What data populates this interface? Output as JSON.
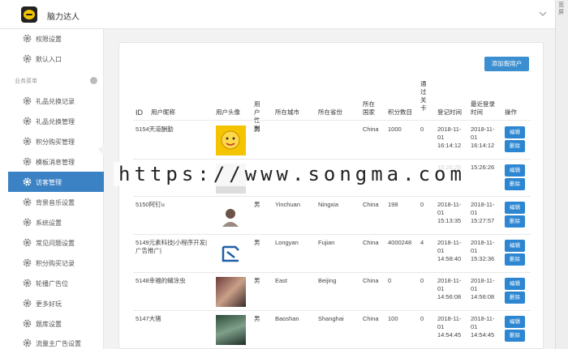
{
  "app": {
    "title": "脑力达人"
  },
  "rightstrip": {
    "text": "宽屏"
  },
  "sidebar": {
    "section_label": "业务菜单",
    "items": [
      {
        "label": "权限设置"
      },
      {
        "label": "默认入口"
      },
      {
        "label": "礼品兑换记录"
      },
      {
        "label": "礼品兑换管理"
      },
      {
        "label": "积分购买管理"
      },
      {
        "label": "模板消息管理"
      },
      {
        "label": "访客管理",
        "active": true
      },
      {
        "label": "背景音乐设置"
      },
      {
        "label": "系统设置"
      },
      {
        "label": "常见问题设置"
      },
      {
        "label": "积分购买记录"
      },
      {
        "label": "轮播广告位"
      },
      {
        "label": "更多好玩"
      },
      {
        "label": "题库设置"
      },
      {
        "label": "流量主广告设置"
      }
    ]
  },
  "toolbar": {
    "add_user_label": "添加假用户"
  },
  "table": {
    "headers": {
      "id": "ID",
      "nickname": "用户昵称",
      "avatar": "用户头像",
      "gender": "用户性别",
      "city": "所在城市",
      "province": "所在省份",
      "country": "所在国家",
      "points": "积分数目",
      "pass": "通过关卡",
      "login_time": "登记时间",
      "last_login": "最近登录时间",
      "action": "操作"
    },
    "edit_label": "编辑",
    "delete_label": "删除",
    "rows": [
      {
        "idname": "5154天道酬勤",
        "gender": "男",
        "city": "",
        "province": "",
        "country": "China",
        "points": "1000",
        "pass": "0",
        "reg": "2018-11-01 16:14:12",
        "last": "2018-11-01 16:14:12"
      },
      {
        "idname": "",
        "gender": "",
        "city": "",
        "province": "",
        "country": "",
        "points": "",
        "pass": "",
        "reg": "15:26:26",
        "last": "15:26:26"
      },
      {
        "idname": "5150阿钉u",
        "gender": "男",
        "city": "Yinchuan",
        "province": "Ningxia",
        "country": "China",
        "points": "198",
        "pass": "0",
        "reg": "2018-11-01 15:13:35",
        "last": "2018-11-01 15:27:57"
      },
      {
        "idname": "5149元素科技|小程序开发|广告推广|",
        "gender": "男",
        "city": "Longyan",
        "province": "Fujian",
        "country": "China",
        "points": "4000248",
        "pass": "4",
        "reg": "2018-11-01 14:58:40",
        "last": "2018-11-01 15:32:36"
      },
      {
        "idname": "5148幸福的蝴涂虫",
        "gender": "男",
        "city": "East",
        "province": "Beijing",
        "country": "China",
        "points": "0",
        "pass": "0",
        "reg": "2018-11-01 14:56:08",
        "last": "2018-11-01 14:56:08"
      },
      {
        "idname": "5147大猪",
        "gender": "男",
        "city": "Baoshan",
        "province": "Shanghai",
        "country": "China",
        "points": "100",
        "pass": "0",
        "reg": "2018-11-01 14:54:45",
        "last": "2018-11-01 14:54:45"
      }
    ]
  },
  "watermark": "https://www.songma.com"
}
